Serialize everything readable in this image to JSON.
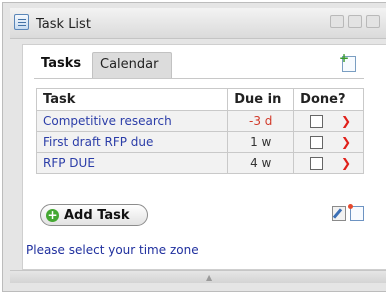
{
  "window": {
    "title": "Task List",
    "icon": "task-list-icon"
  },
  "tabs": [
    {
      "label": "Tasks",
      "active": true
    },
    {
      "label": "Calendar",
      "active": false
    }
  ],
  "table": {
    "headers": [
      "Task",
      "Due in",
      "Done?"
    ],
    "rows": [
      {
        "task": "Competitive research",
        "due": "-3 d",
        "overdue": true,
        "done": false
      },
      {
        "task": "First draft RFP due",
        "due": "1 w",
        "overdue": false,
        "done": false
      },
      {
        "task": "RFP DUE",
        "due": "4 w",
        "overdue": false,
        "done": false
      }
    ]
  },
  "actions": {
    "add_task_label": "Add Task"
  },
  "footer": {
    "timezone_link": "Please select your time zone"
  },
  "colors": {
    "link": "#2b3da8",
    "overdue": "#d23a2a",
    "arrow": "#e0201a",
    "add_icon": "#44a832"
  }
}
